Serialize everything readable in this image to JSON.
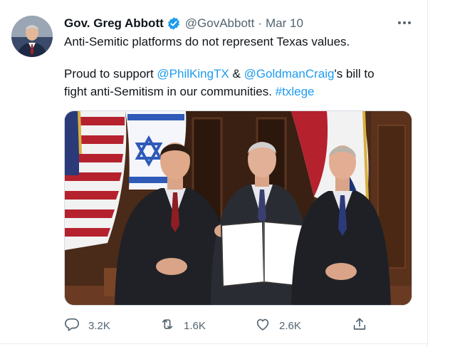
{
  "tweet": {
    "author_name": "Gov. Greg Abbott",
    "handle": "@GovAbbott",
    "separator": "·",
    "date": "Mar 10",
    "text_line1": "Anti-Semitic platforms do not represent Texas values.",
    "line2_prefix": "Proud to support ",
    "mention1": "@PhilKingTX",
    "line2_mid": " & ",
    "mention2": "@GoldmanCraig",
    "line2_suffix": "'s bill to",
    "line3_prefix": "fight anti-Semitism in our communities. ",
    "hashtag": "#txlege"
  },
  "actions": {
    "replies": "3.2K",
    "retweets": "1.6K",
    "likes": "2.6K"
  },
  "colors": {
    "link": "#1d9bf0",
    "verified": "#1d9bf0",
    "muted": "#536471"
  },
  "icons": [
    "verified-badge-icon",
    "more-icon",
    "reply-icon",
    "retweet-icon",
    "like-icon",
    "share-icon"
  ]
}
